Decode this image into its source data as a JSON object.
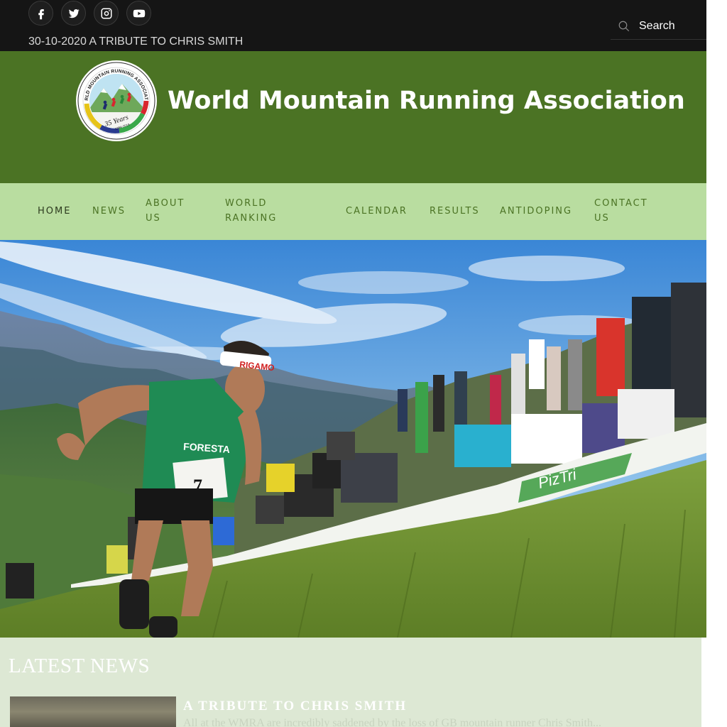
{
  "topbar": {
    "social": [
      {
        "icon": "facebook-icon"
      },
      {
        "icon": "twitter-icon"
      },
      {
        "icon": "instagram-icon"
      },
      {
        "icon": "youtube-icon"
      }
    ],
    "ticker": "30-10-2020 A TRIBUTE TO CHRIS SMITH",
    "search": {
      "placeholder": "Search",
      "icon": "search-icon"
    }
  },
  "header": {
    "title": "World Mountain Running Association",
    "logo": {
      "ring_text": "WORLD MOUNTAIN RUNNING ASSOCIATION",
      "badge_text": "35 Years",
      "years": "1984-2019"
    },
    "background": "#4b7324"
  },
  "nav": {
    "background": "#b9dda0",
    "items": [
      {
        "label": "HOME",
        "active": true
      },
      {
        "label": "NEWS"
      },
      {
        "label": "ABOUT US"
      },
      {
        "label": "WORLD RANKING"
      },
      {
        "label": "CALENDAR"
      },
      {
        "label": "RESULTS"
      },
      {
        "label": "ANTIDOPING"
      },
      {
        "label": "CONTACT US"
      }
    ]
  },
  "hero": {
    "bib_number": "7",
    "jersey_text": "FORESTA",
    "headband_text": "RIGAMO",
    "banner_text": "PizTri"
  },
  "news": {
    "heading": "LATEST NEWS",
    "articles": [
      {
        "title": "A TRIBUTE TO CHRIS SMITH",
        "excerpt": "All at the WMRA are incredibly saddened by the loss of GB mountain runner Chris Smith..."
      }
    ]
  }
}
